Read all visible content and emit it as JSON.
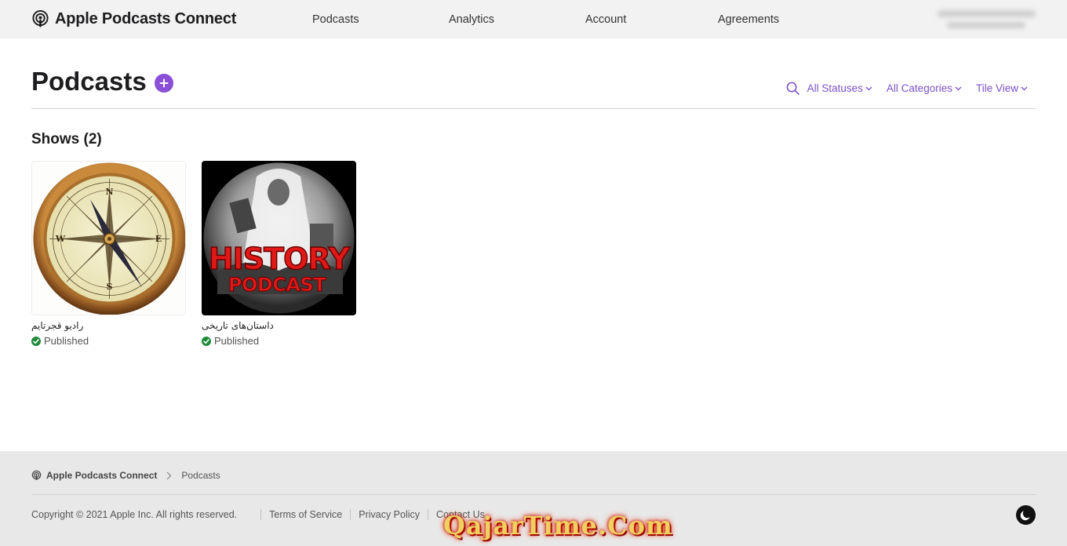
{
  "app": {
    "brand": "Apple Podcasts Connect"
  },
  "nav": {
    "items": [
      {
        "label": "Podcasts"
      },
      {
        "label": "Analytics"
      },
      {
        "label": "Account"
      },
      {
        "label": "Agreements"
      }
    ]
  },
  "header": {
    "title": "Podcasts"
  },
  "toolbar": {
    "status_filter": "All Statuses",
    "category_filter": "All Categories",
    "view_filter": "Tile View"
  },
  "shows": {
    "title": "Shows (2)",
    "items": [
      {
        "name": "رادیو قجرتایم",
        "status": "Published"
      },
      {
        "name": "داستان‌های تاریخی",
        "status": "Published",
        "art_text_1": "HISTORY",
        "art_text_2": "PODCAST"
      }
    ]
  },
  "footer": {
    "breadcrumb_brand": "Apple Podcasts Connect",
    "breadcrumb_page": "Podcasts",
    "copyright": "Copyright © 2021 Apple Inc. All rights reserved.",
    "links": [
      "Terms of Service",
      "Privacy Policy",
      "Contact Us"
    ]
  },
  "watermark": "QajarTime.Com",
  "colors": {
    "accent": "#7b52c7",
    "published": "#1e8a3a",
    "nav_bg": "#f2f2f2",
    "footer_bg": "#e8e8e8"
  }
}
